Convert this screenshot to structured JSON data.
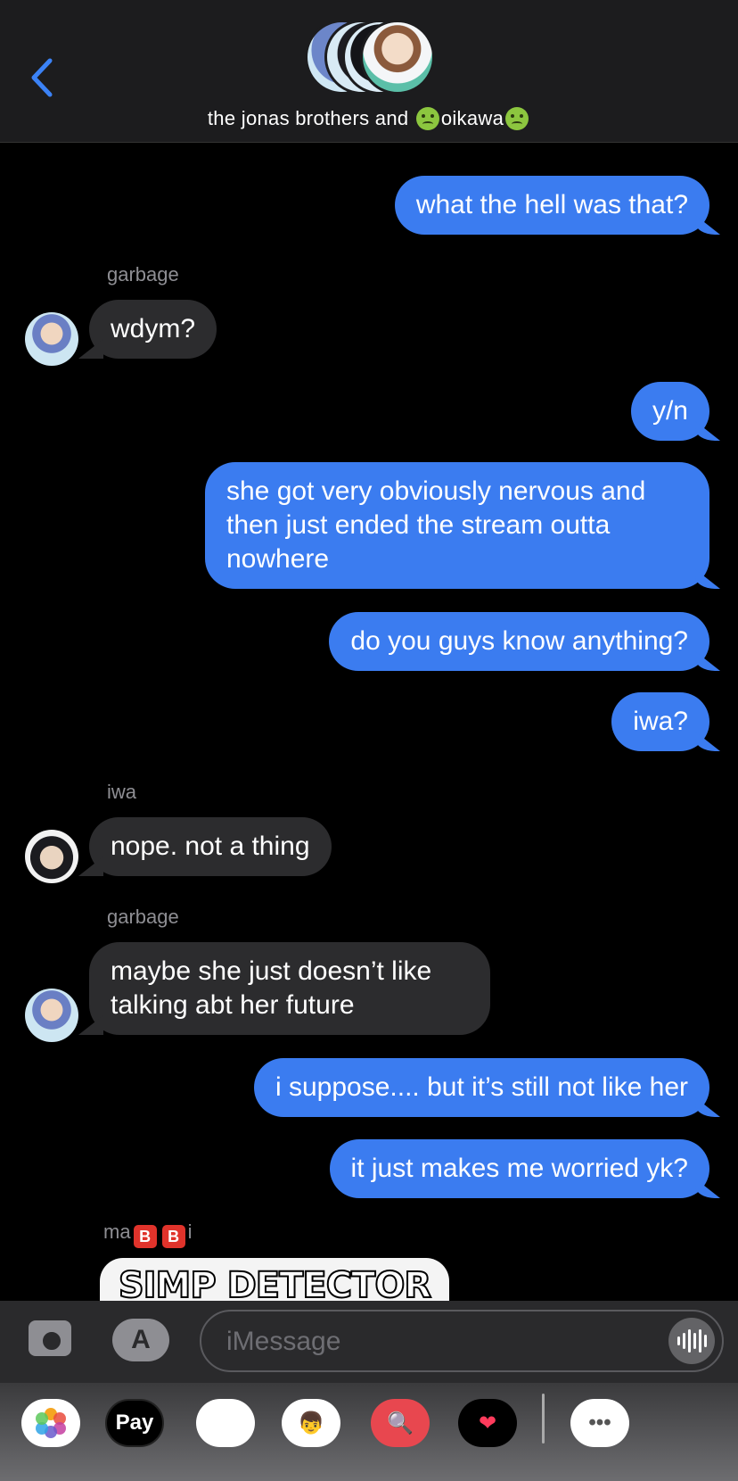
{
  "header": {
    "back_label": "back",
    "title_left": "the jonas brothers and ",
    "title_right": "oikawa"
  },
  "messages": [
    {
      "dir": "out",
      "text": "what the hell was that?"
    },
    {
      "dir": "sender",
      "text": "garbage"
    },
    {
      "dir": "in",
      "text": "wdym?"
    },
    {
      "dir": "out",
      "text": "y/n"
    },
    {
      "dir": "out",
      "text": "she got very obviously nervous and then just ended the stream outta nowhere"
    },
    {
      "dir": "out",
      "text": "do you guys know anything?"
    },
    {
      "dir": "out",
      "text": "iwa?"
    },
    {
      "dir": "sender",
      "text": "iwa"
    },
    {
      "dir": "in",
      "text": "nope. not a thing"
    },
    {
      "dir": "sender",
      "text": "garbage"
    },
    {
      "dir": "in",
      "text": "maybe she just doesn’t like talking abt her future"
    },
    {
      "dir": "out",
      "text": "i suppose.... but it’s still not like her"
    },
    {
      "dir": "out",
      "text": "it just makes me worried yk?"
    }
  ],
  "last_sender": {
    "prefix": "ma",
    "b1": "B",
    "b2": "B",
    "suffix": "i"
  },
  "sticker_text": "SIMP DETECTOR",
  "input": {
    "placeholder": "iMessage"
  },
  "apps": [
    {
      "name": "photos-app-icon",
      "label": ""
    },
    {
      "name": "apple-pay-app-icon",
      "label": "Pay"
    },
    {
      "name": "animoji-app-icon",
      "label": "🐵"
    },
    {
      "name": "memoji-app-icon",
      "label": "👦"
    },
    {
      "name": "web-search-app-icon",
      "label": "🔍"
    },
    {
      "name": "digital-touch-app-icon",
      "label": "❤"
    },
    {
      "name": "more-apps-icon",
      "label": "•••"
    }
  ]
}
